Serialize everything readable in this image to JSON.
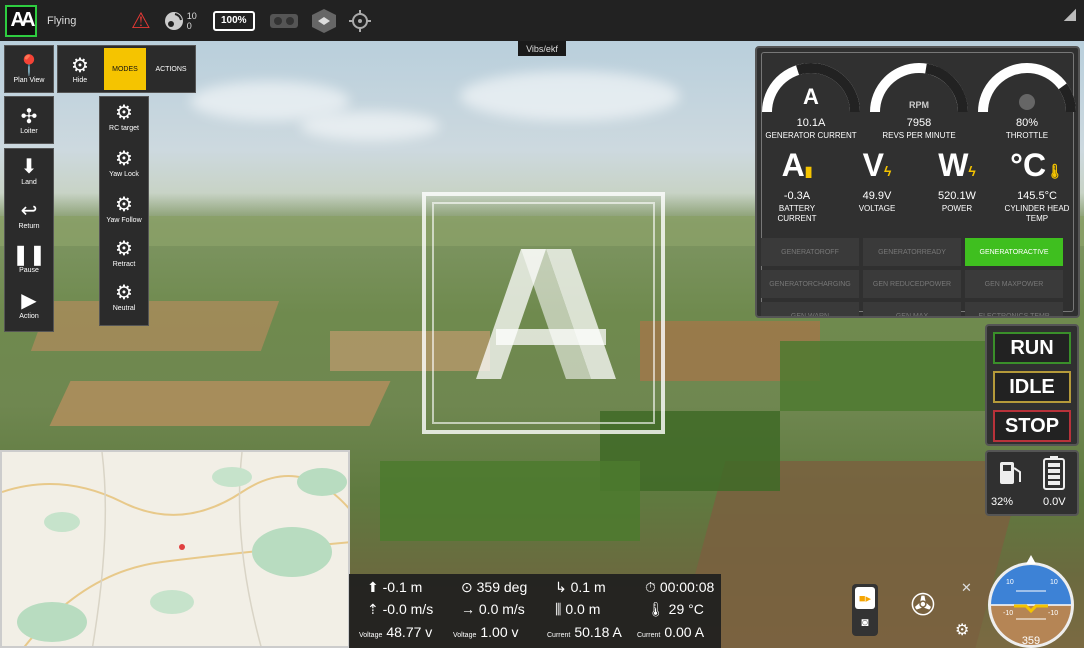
{
  "topbar": {
    "logo_text": "AA",
    "flight_mode": "Flying",
    "satellite_count": "10",
    "satellite_hdop": "0",
    "battery": "100%"
  },
  "vibs_label": "Vibs/ekf",
  "tools": {
    "plan_view": "Plan View",
    "loiter": "Loiter",
    "land": "Land",
    "return": "Return",
    "pause": "Pause",
    "action": "Action",
    "hide": "Hide",
    "modes": "MODES",
    "actions": "ACTIONS",
    "rc_target": "RC target",
    "yaw_lock": "Yaw Lock",
    "yaw_follow": "Yaw Follow",
    "retract": "Retract",
    "neutral": "Neutral"
  },
  "gauges": {
    "generator_current": {
      "value": "10.1A",
      "label": "GENERATOR CURRENT",
      "level": 0.4
    },
    "rpm": {
      "value": "7958",
      "label": "REVS PER MINUTE",
      "unit": "RPM",
      "level": 0.55
    },
    "throttle": {
      "value": "80%",
      "label": "THROTTLE",
      "level": 0.8
    }
  },
  "stats": {
    "battery_current": {
      "value": "-0.3A",
      "label1": "BATTERY",
      "label2": "CURRENT"
    },
    "voltage": {
      "value": "49.9V",
      "label": "VOLTAGE"
    },
    "power": {
      "value": "520.1W",
      "label": "POWER"
    },
    "cylinder_temp": {
      "value": "145.5°C",
      "label1": "CYLINDER HEAD",
      "label2": "TEMP"
    }
  },
  "gen_status": [
    {
      "l1": "GENERATOR",
      "l2": "OFF",
      "active": false
    },
    {
      "l1": "GENERATOR",
      "l2": "READY",
      "active": false
    },
    {
      "l1": "GENERATOR",
      "l2": "ACTIVE",
      "active": true
    },
    {
      "l1": "GENERATOR",
      "l2": "CHARGING",
      "active": false
    },
    {
      "l1": "GEN REDUCED",
      "l2": "POWER",
      "active": false
    },
    {
      "l1": "GEN MAX",
      "l2": "POWER",
      "active": false
    },
    {
      "l1": "GEN WARN",
      "l2": "",
      "active": false
    },
    {
      "l1": "GEN MAX",
      "l2": "",
      "active": false
    },
    {
      "l1": "ELECTRONICS TEMP",
      "l2": "",
      "active": false
    }
  ],
  "controls": {
    "run": "RUN",
    "idle": "IDLE",
    "stop": "STOP"
  },
  "fuel": {
    "fuel_level": "32%",
    "battery_voltage": "0.0V"
  },
  "telemetry": {
    "altitude": "-0.1 m",
    "heading": "359 deg",
    "distance": "0.1 m",
    "flight_time": "00:00:08",
    "vertical_speed": "-0.0 m/s",
    "ground_speed": "0.0 m/s",
    "dist_home": "0.0 m",
    "temperature": "29 °C",
    "voltage1_label": "Voltage",
    "voltage1": "48.77 v",
    "voltage2_label": "Voltage",
    "voltage2": "1.00 v",
    "current1_label": "Current",
    "current1": "50.18 A",
    "current2_label": "Current",
    "current2": "0.00 A"
  },
  "attitude": {
    "heading": "359",
    "pitch_up": "10",
    "pitch_down": "-10"
  },
  "colors": {
    "accent_yellow": "#f5c400",
    "active_green": "#3fbf1f",
    "run_green": "#3a8f2a",
    "idle_gold": "#b59a3a",
    "stop_red": "#b8323a"
  }
}
